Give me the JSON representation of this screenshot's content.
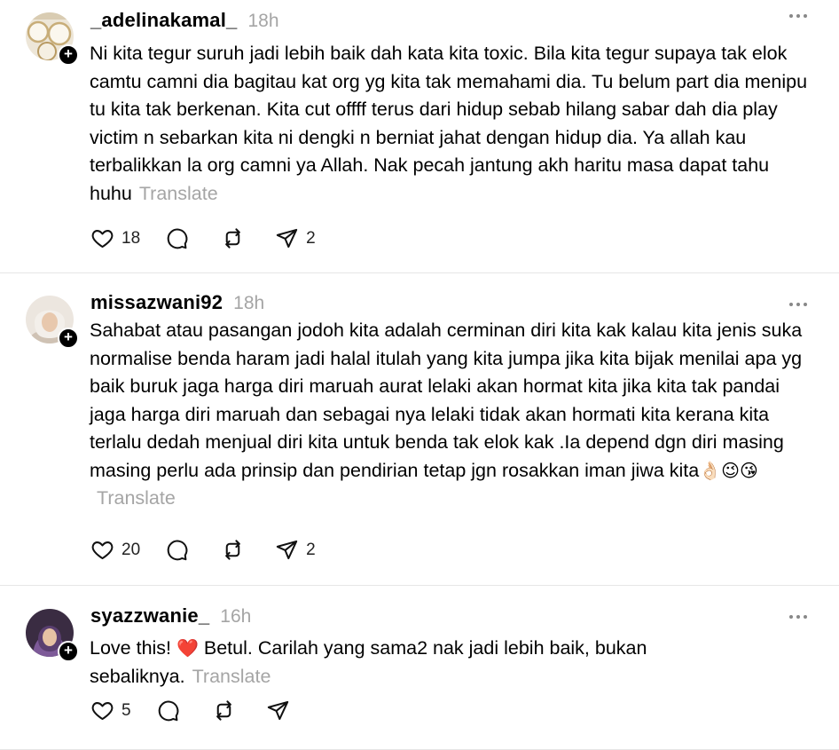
{
  "posts": [
    {
      "username": "_adelinakamal_",
      "time": "18h",
      "text": "Ni kita tegur suruh jadi lebih baik dah kata kita toxic. Bila kita tegur supaya tak elok camtu camni dia bagitau kat org yg kita tak memahami dia. Tu belum part dia menipu tu kita tak berkenan. Kita cut offff terus dari hidup sebab hilang sabar dah dia play victim n sebarkan kita ni dengki n berniat jahat dengan hidup dia. Ya allah kau terbalikkan la org camni ya Allah. Nak pecah jantung akh haritu masa dapat tahu huhu",
      "translate": "Translate",
      "likes": "18",
      "shares": "2",
      "avatar_colors": [
        "#e9e1d2",
        "#c9b48a"
      ]
    },
    {
      "username": "missazwani92",
      "time": "18h",
      "text": "Sahabat atau pasangan jodoh kita adalah cerminan diri kita kak kalau kita jenis suka normalise benda haram jadi halal itulah yang kita jumpa jika kita bijak menilai apa yg baik buruk jaga harga diri maruah aurat lelaki akan hormat kita jika kita tak pandai jaga harga diri maruah dan sebagai nya lelaki tidak akan hormati kita kerana kita terlalu dedah menjual diri kita untuk benda tak elok kak .Ia depend dgn diri masing masing perlu ada prinsip dan pendirian tetap jgn rosakkan iman jiwa kita",
      "emojis": "👌🏻😉😘",
      "translate": "Translate",
      "likes": "20",
      "shares": "2",
      "avatar_colors": [
        "#f0ebe6",
        "#d8c6b6"
      ]
    },
    {
      "username": "syazzwanie_",
      "time": "16h",
      "text_before": "Love this! ",
      "heart": "❤️",
      "text_after": " Betul. Carilah yang sama2 nak jadi lebih baik, bukan sebaliknya.",
      "translate": "Translate",
      "likes": "5",
      "shares": "",
      "avatar_colors": [
        "#2b2030",
        "#8a6aa0"
      ]
    }
  ],
  "colors": {
    "heart_emoji": "#e0245e",
    "muted": "#a5a5a5"
  },
  "icons": [
    "heart-icon",
    "comment-icon",
    "repost-icon",
    "share-icon",
    "more-icon",
    "follow-plus-icon"
  ]
}
